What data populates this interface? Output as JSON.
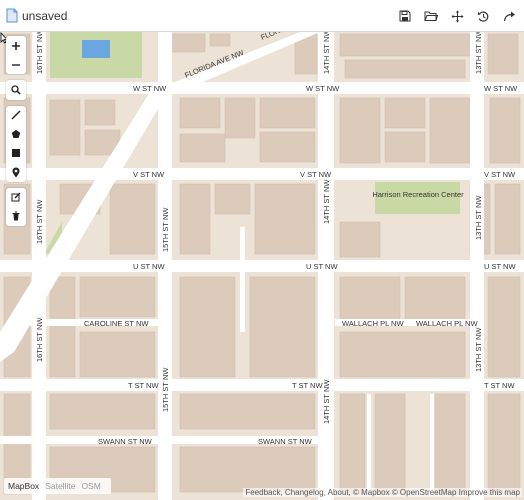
{
  "app": {
    "title": "unsaved"
  },
  "top_toolbar": {
    "buttons": [
      {
        "name": "save-icon"
      },
      {
        "name": "open-folder-icon"
      },
      {
        "name": "move-icon"
      },
      {
        "name": "undo-icon"
      },
      {
        "name": "share-icon"
      }
    ]
  },
  "left_toolbar": {
    "tools": [
      {
        "name": "zoom-in-icon"
      },
      {
        "name": "zoom-out-icon"
      },
      {
        "name": "search-icon"
      },
      {
        "name": "draw-line-icon"
      },
      {
        "name": "draw-polygon-icon"
      },
      {
        "name": "draw-rectangle-icon"
      },
      {
        "name": "draw-marker-icon"
      },
      {
        "name": "edit-icon"
      },
      {
        "name": "trash-icon"
      }
    ]
  },
  "map": {
    "streets": {
      "w_st": "W ST NW",
      "v_st": "V ST NW",
      "u_st": "U ST NW",
      "t_st": "T ST NW",
      "swann_st": "SWANN ST NW",
      "caroline_st": "CAROLINE ST NW",
      "wallach_pl": "WALLACH PL NW",
      "florida_ave": "FLORIDA AVE NW",
      "florida_short": "FLORI",
      "st_16th": "16TH ST NW",
      "st_15th": "15TH ST NW",
      "st_14th": "14TH ST NW",
      "st_13th": "13TH ST NW"
    },
    "pois": {
      "harrison": "Harrison Recreation Center"
    },
    "colors": {
      "land": "#ece2d6",
      "building": "#dccbbb",
      "road": "#ffffff",
      "park": "#c9d9a6",
      "water": "#6aa6e0"
    }
  },
  "layers": {
    "options": [
      "MapBox",
      "Satellite",
      "OSM"
    ],
    "active": "MapBox"
  },
  "attribution": {
    "feedback": "Feedback",
    "changelog": "Changelog",
    "about": "About",
    "mapbox": "© Mapbox",
    "osm": "© OpenStreetMap",
    "improve": "Improve this map"
  }
}
